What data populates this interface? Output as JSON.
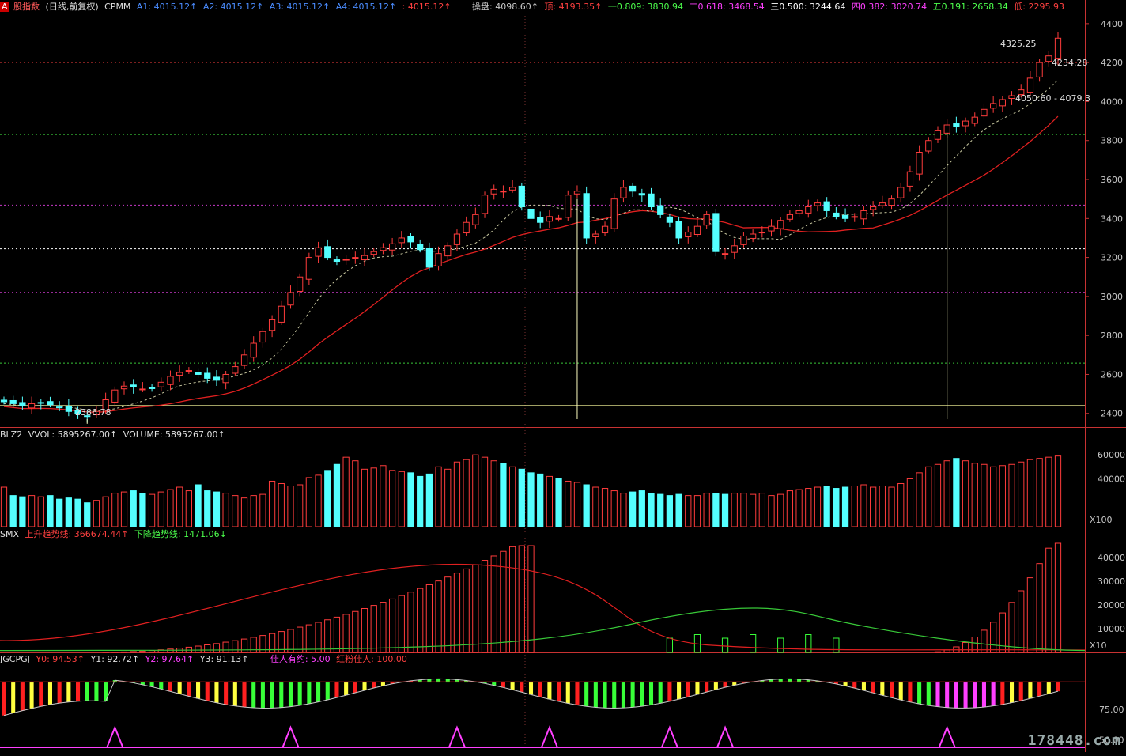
{
  "header_main": {
    "icon_text": "A",
    "title": "股指数",
    "period": "(日线,前复权)",
    "indicator": "CPMM",
    "a1": "A1: 4015.12↑",
    "a2": "A2: 4015.12↑",
    "a3": "A3: 4015.12↑",
    "a4": "A4: 4015.12↑",
    "a5": ": 4015.12↑",
    "cp": "操盘: 4098.60↑",
    "top": "顶: 4193.35↑",
    "l1": "一0.809: 3830.94",
    "l2": "二0.618: 3468.54",
    "l3": "三0.500: 3244.64",
    "l4": "四0.382: 3020.74",
    "l5": "五0.191: 2658.34",
    "low": "低: 2295.93"
  },
  "header_vol": {
    "name": "BLZ2",
    "vvol": "VVOL: 5895267.00↑",
    "volume": "VOLUME: 5895267.00↑"
  },
  "header_smx": {
    "name": "SMX",
    "up": "上升趋势线: 366674.44↑",
    "down": "下降趋势线: 1471.06↓"
  },
  "header_jg": {
    "name": "JGCPGJ",
    "y0": "Y0: 94.53↑",
    "y1": "Y1: 92.72↑",
    "y2": "Y2: 97.64↑",
    "y3": "Y3: 91.13↑",
    "jr": "佳人有约: 5.00",
    "hf": "红粉佳人: 100.00"
  },
  "annotations": {
    "high": "4325.25",
    "last": "4234.28",
    "range": "4050.60 - 4079.3",
    "low": "2386.78"
  },
  "watermark": "178448.com",
  "colors": {
    "up": "#ff3c3c",
    "down": "#54ffff",
    "down_bear": "#3050ff",
    "magenta": "#ff40ff",
    "green": "#38ff38",
    "yellow": "#ffff40",
    "axis": "#c83232",
    "grid_text": "#c8c8c8"
  },
  "chart_data": [
    {
      "type": "candlestick",
      "name": "price",
      "y_axis_ticks": [
        2400,
        2600,
        2800,
        3000,
        3200,
        3400,
        3600,
        3800,
        4000,
        4200,
        4400
      ],
      "ylim": [
        2330,
        4440
      ],
      "fib_levels": [
        3830.94,
        3468.54,
        3244.64,
        3020.74,
        2658.34
      ],
      "series_close": [
        2460,
        2450,
        2440,
        2450,
        2455,
        2445,
        2430,
        2410,
        2400,
        2386.78,
        2410,
        2470,
        2520,
        2540,
        2535,
        2525,
        2530,
        2560,
        2590,
        2610,
        2620,
        2600,
        2580,
        2570,
        2600,
        2640,
        2700,
        2760,
        2820,
        2880,
        2950,
        3020,
        3100,
        3200,
        3250,
        3200,
        3180,
        3190,
        3200,
        3210,
        3230,
        3250,
        3270,
        3300,
        3280,
        3240,
        3150,
        3220,
        3260,
        3320,
        3380,
        3420,
        3520,
        3550,
        3540,
        3560,
        3460,
        3400,
        3380,
        3410,
        3400,
        3520,
        3540,
        3300,
        3320,
        3360,
        3500,
        3560,
        3540,
        3520,
        3460,
        3420,
        3380,
        3300,
        3330,
        3360,
        3420,
        3230,
        3220,
        3260,
        3310,
        3320,
        3330,
        3360,
        3390,
        3420,
        3440,
        3460,
        3480,
        3440,
        3410,
        3400,
        3410,
        3440,
        3460,
        3480,
        3500,
        3560,
        3640,
        3740,
        3800,
        3850,
        3880,
        3870,
        3900,
        3920,
        3960,
        3990,
        4010,
        4030,
        4060,
        4120,
        4200,
        4234.28,
        4325.25
      ],
      "ma_slow_note": "red slow moving average line"
    },
    {
      "type": "bar",
      "name": "volume",
      "y_axis_ticks": [
        40000,
        60000
      ],
      "unit_label": "X100",
      "values": [
        33,
        26,
        25,
        26,
        25,
        26,
        23,
        24,
        23,
        20,
        22,
        25,
        28,
        29,
        30,
        28,
        27,
        29,
        31,
        33,
        30,
        35,
        30,
        29,
        28,
        26,
        24,
        26,
        27,
        38,
        36,
        34,
        35,
        41,
        43,
        47,
        52,
        58,
        55,
        48,
        49,
        51,
        47,
        46,
        45,
        42,
        44,
        50,
        48,
        54,
        56,
        60,
        58,
        55,
        53,
        50,
        48,
        45,
        44,
        42,
        40,
        38,
        37,
        35,
        33,
        32,
        30,
        28,
        29,
        30,
        28,
        27,
        26,
        27,
        26,
        26,
        28,
        28,
        27,
        28,
        28,
        27,
        28,
        26,
        27,
        30,
        31,
        32,
        33,
        34,
        32,
        33,
        34,
        35,
        33,
        34,
        33,
        36,
        40,
        45,
        50,
        52,
        55,
        57,
        55,
        53,
        52,
        50,
        51,
        52,
        54,
        56,
        57,
        58,
        59,
        60
      ],
      "ylim": [
        0,
        70000
      ]
    },
    {
      "type": "bar",
      "name": "trend",
      "y_axis_ticks": [
        10000,
        20000,
        30000,
        40000
      ],
      "unit_label": "X10",
      "ylim": [
        0,
        47000
      ]
    },
    {
      "type": "area",
      "name": "oscillator",
      "y_axis_ticks": [
        50.0,
        75.0
      ],
      "ylim": [
        40,
        110
      ]
    }
  ]
}
